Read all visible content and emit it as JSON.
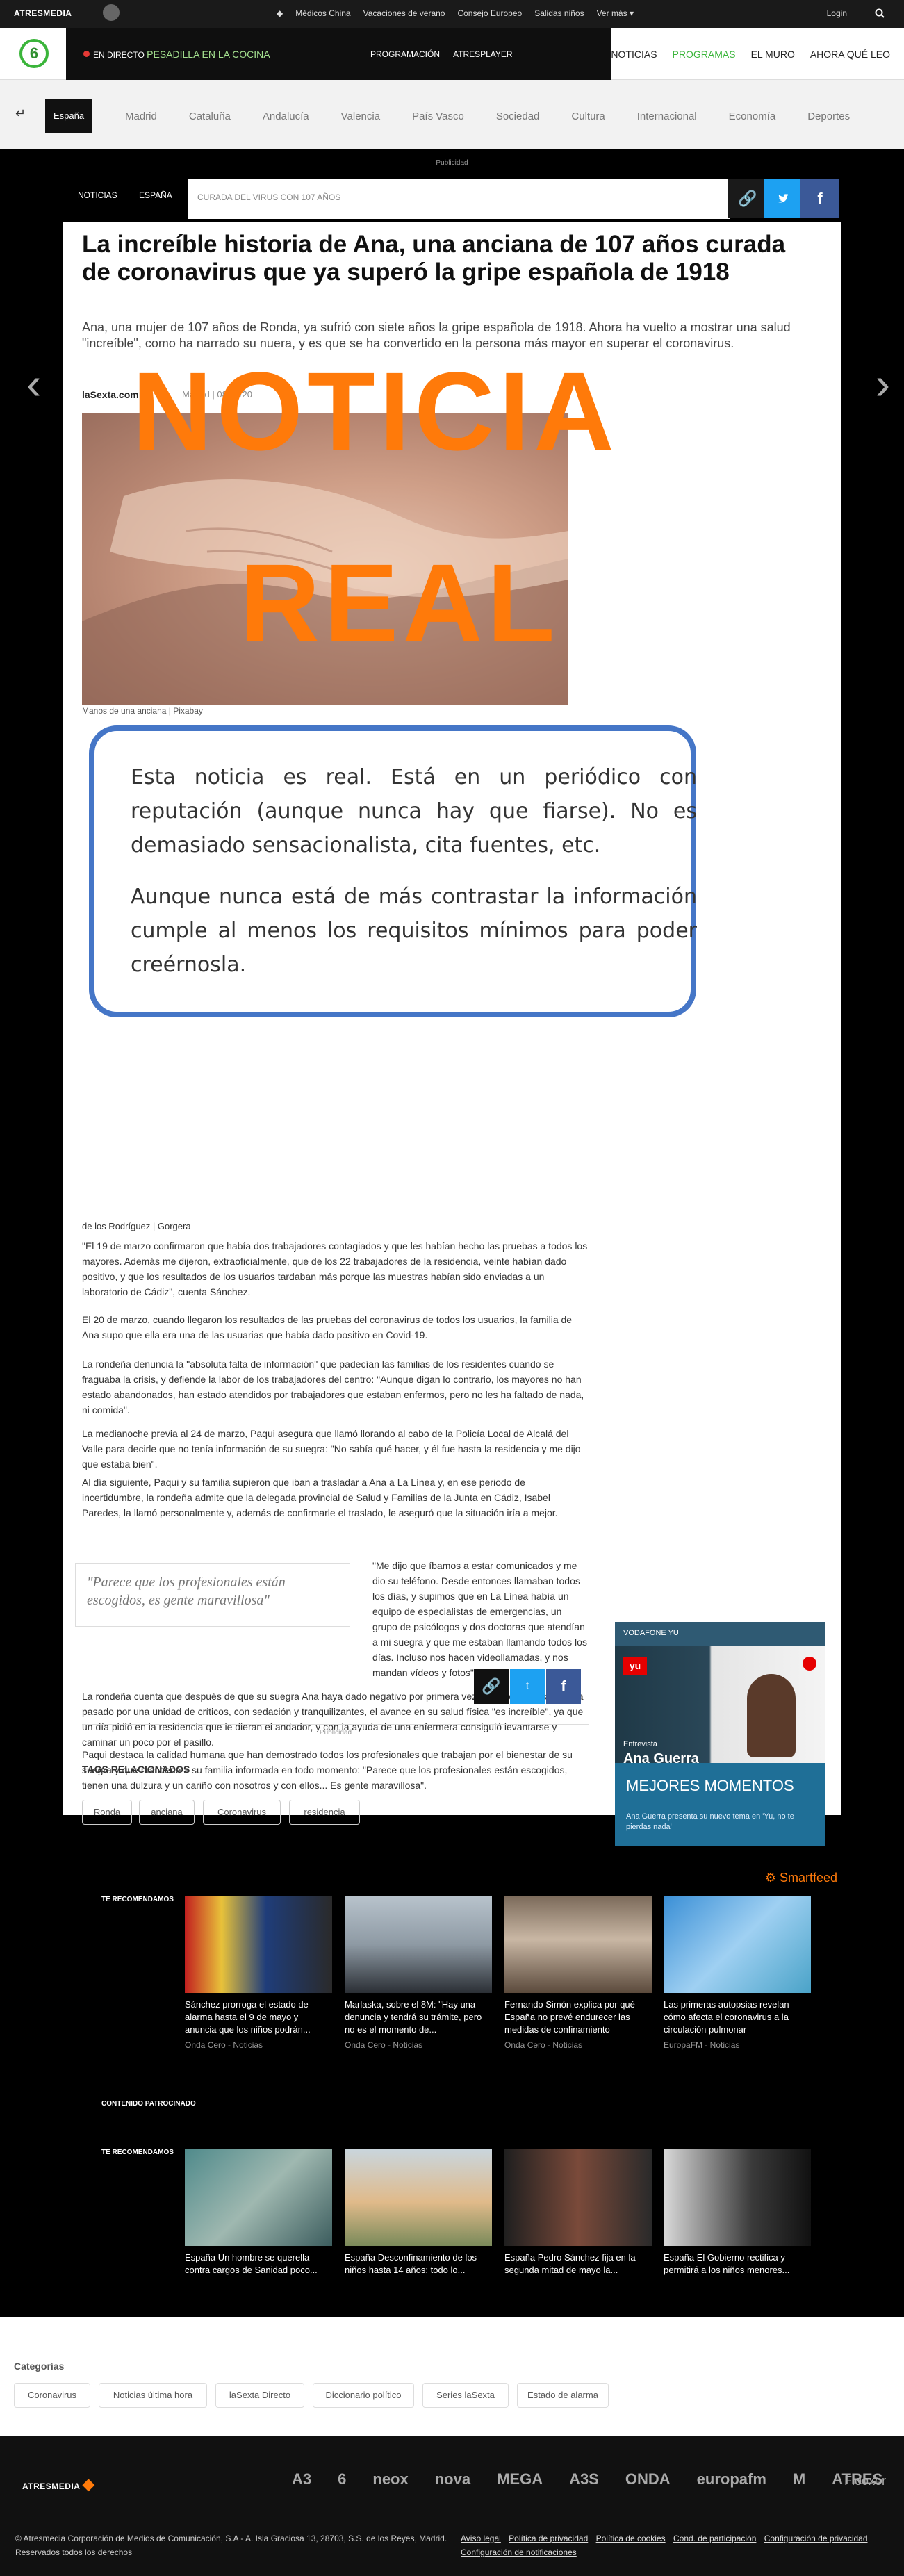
{
  "topbar": {
    "brand": "ATRESMEDIA",
    "trending": [
      "Médicos China",
      "Vacaciones de verano",
      "Consejo Europeo",
      "Salidas niños",
      "Ver más"
    ],
    "login": "Login"
  },
  "channel": {
    "logo": "6",
    "live_prefix": "EN DIRECTO",
    "live_show": "PESADILLA EN LA COCINA",
    "programacion": "PROGRAMACIÓN",
    "atresplayer": "ATRESPLAYER",
    "menu": [
      "NOTICIAS",
      "PROGRAMAS",
      "EL MURO",
      "AHORA QUÉ LEO"
    ]
  },
  "sections": {
    "active": "España",
    "items": [
      "Madrid",
      "Cataluña",
      "Andalucía",
      "Valencia",
      "País Vasco",
      "Sociedad",
      "Cultura",
      "Internacional",
      "Economía",
      "Deportes"
    ]
  },
  "ads": {
    "label": "Publicidad"
  },
  "article": {
    "crumb_1": "NOTICIAS",
    "crumb_2": "ESPAÑA",
    "tag": "CURADA DEL VIRUS CON 107 AÑOS",
    "title": "La increíble historia de Ana, una anciana de 107 años curada de coronavirus que ya superó la gripe española de 1918",
    "subtitle": "Ana, una mujer de 107 años de Ronda, ya sufrió con siete años la gripe española de 1918. Ahora ha vuelto a mostrar una salud \"increíble\", como ha narrado su nuera, y es que se ha convertido en la persona más mayor en superar el coronavirus.",
    "author": "laSexta.com",
    "date": "Madrid | 08/04/20",
    "caption": "Manos de una anciana | Pixabay",
    "stamp_1": "NOTICIA",
    "stamp_2": "REAL",
    "note_1": "Esta noticia es real. Está en un periódico con reputación (aunque nunca hay que fiarse). No es demasiado sensacionalista, cita fuentes, etc.",
    "note_2": "Aunque nunca está de más contrastar la información cumple al menos los requisitos mínimos para poder creérnosla.",
    "cut_line": "de los Rodríguez | Gorgera",
    "p1": "\"El 19 de marzo confirmaron que había dos trabajadores contagiados y que les habían hecho las pruebas a todos los mayores. Además me dijeron, extraoficialmente, que de los 22 trabajadores de la residencia, veinte habían dado positivo, y que los resultados de los usuarios tardaban más porque las muestras habían sido enviadas a un laboratorio de Cádiz\", cuenta Sánchez.",
    "p2": "El 20 de marzo, cuando llegaron los resultados de las pruebas del coronavirus de todos los usuarios, la familia de Ana supo que ella era una de las usuarias que había dado positivo en Covid-19.",
    "p3": "La rondeña denuncia la \"absoluta falta de información\" que padecían las familias de los residentes cuando se fraguaba la crisis, y defiende la labor de los trabajadores del centro: \"Aunque digan lo contrario, los mayores no han estado abandonados, han estado atendidos por trabajadores que estaban enfermos, pero no les ha faltado de nada, ni comida\".",
    "p4": "La medianoche previa al 24 de marzo, Paqui asegura que llamó llorando al cabo de la Policía Local de Alcalá del Valle para decirle que no tenía información de su suegra: \"No sabía qué hacer, y él fue hasta la residencia y me dijo que estaba bien\".",
    "p5": "Al día siguiente, Paqui y su familia supieron que iban a trasladar a Ana a La Línea y, en ese periodo de incertidumbre, la rondeña admite que la delegada provincial de Salud y Familias de la Junta en Cádiz, Isabel Paredes, la llamó personalmente y, además de confirmarle el traslado, le aseguró que la situación iría a mejor.",
    "quote": "\"Parece que los profesionales están escogidos, es gente maravillosa\"",
    "p6": "\"Me dijo que íbamos a estar comunicados y me dio su teléfono. Desde entonces llamaban todos los días, y supimos que en La Línea había un equipo de especialistas de emergencias, un grupo de psicólogos y dos doctoras que atendían a mi suegra y que me estaban llamando todos los días. Incluso nos hacen videollamadas, y nos mandan vídeos y fotos\", sostiene Paqui.",
    "p7": "La rondeña cuenta que después de que su suegra Ana haya dado negativo por primera vez en su tercer test, y haya pasado por una unidad de críticos, con sedación y tranquilizantes, el avance en su salud física \"es increíble\", ya que un día pidió en la residencia que le dieran el andador, y con la ayuda de una enfermera consiguió levantarse y caminar un poco por el pasillo.",
    "p8": "Paqui destaca la calidad humana que han demostrado todos los profesionales que trabajan por el bienestar de su suegra y que mantiene a su familia informada en todo momento: \"Parece que los profesionales están escogidos, tienen una dulzura y un cariño con nosotros y con ellos... Es gente maravillosa\".",
    "tags_title": "TAGS RELACIONADOS",
    "tags": [
      "Ronda",
      "anciana",
      "Coronavirus",
      "residencia"
    ]
  },
  "sidebar": {
    "yu_label": "VODAFONE YU",
    "yu_logo": "yu",
    "yu_kicker": "Entrevista",
    "yu_name": "Ana Guerra",
    "mm_title": "MEJORES MOMENTOS",
    "mm_text": "Ana Guerra presenta su nuevo tema en 'Yu, no te pierdas nada'"
  },
  "smartfeed": "Smartfeed",
  "recommended": {
    "label": "TE RECOMENDAMOS",
    "sponsored": "CONTENIDO PATROCINADO",
    "cards": [
      {
        "title": "Sánchez prorroga el estado de alarma hasta el 9 de mayo y anuncia que los niños podrán...",
        "source": "Onda Cero - Noticias"
      },
      {
        "title": "Marlaska, sobre el 8M: \"Hay una denuncia y tendrá su trámite, pero no es el momento de...",
        "source": "Onda Cero - Noticias"
      },
      {
        "title": "Fernando Simón explica por qué España no prevé endurecer las medidas de confinamiento",
        "source": "Onda Cero - Noticias"
      },
      {
        "title": "Las primeras autopsias revelan cómo afecta el coronavirus a la circulación pulmonar",
        "source": "EuropaFM - Noticias"
      }
    ],
    "cards2": [
      {
        "title": "España Un hombre se querella contra cargos de Sanidad poco..."
      },
      {
        "title": "España Desconfinamiento de los niños hasta 14 años: todo lo..."
      },
      {
        "title": "España Pedro Sánchez fija en la segunda mitad de mayo la..."
      },
      {
        "title": "España El Gobierno rectifica y permitirá a los niños menores..."
      }
    ]
  },
  "categories": {
    "title": "Categorías",
    "items": [
      "Coronavirus",
      "Noticias última hora",
      "laSexta Directo",
      "Diccionario político",
      "Series laSexta",
      "Estado de alarma"
    ]
  },
  "footer": {
    "brand": "ATRESMEDIA",
    "logos": [
      "A3",
      "6",
      "neox",
      "nova",
      "MEGA",
      "A3S",
      "ONDA",
      "europafm",
      "M",
      "ATRES"
    ],
    "rooster": "Flooxer",
    "copyright": "© Atresmedia Corporación de Medios de Comunicación, S.A - A. Isla Graciosa 13, 28703, S.S. de los Reyes, Madrid. Reservados todos los derechos",
    "links": [
      "Aviso legal",
      "Política de privacidad",
      "Política de cookies",
      "Cond. de participación",
      "Configuración de privacidad",
      "Configuración de notificaciones"
    ]
  }
}
